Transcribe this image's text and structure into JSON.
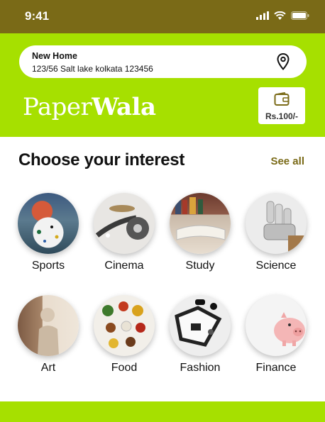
{
  "status": {
    "time": "9:41"
  },
  "address": {
    "title": "New Home",
    "line": "123/56 Salt lake kolkata 123456",
    "icon": "location-pin-icon"
  },
  "brand": {
    "part1": "Paper",
    "part2": "Wala"
  },
  "wallet": {
    "amount": "Rs.100/-",
    "icon": "wallet-icon"
  },
  "section": {
    "title": "Choose your interest",
    "see_all": "See all"
  },
  "interests": [
    {
      "label": "Sports"
    },
    {
      "label": "Cinema"
    },
    {
      "label": "Study"
    },
    {
      "label": "Science"
    },
    {
      "label": "Art"
    },
    {
      "label": "Food"
    },
    {
      "label": "Fashion"
    },
    {
      "label": "Finance"
    }
  ],
  "colors": {
    "lime": "#a6e000",
    "olive": "#7a6a17"
  }
}
